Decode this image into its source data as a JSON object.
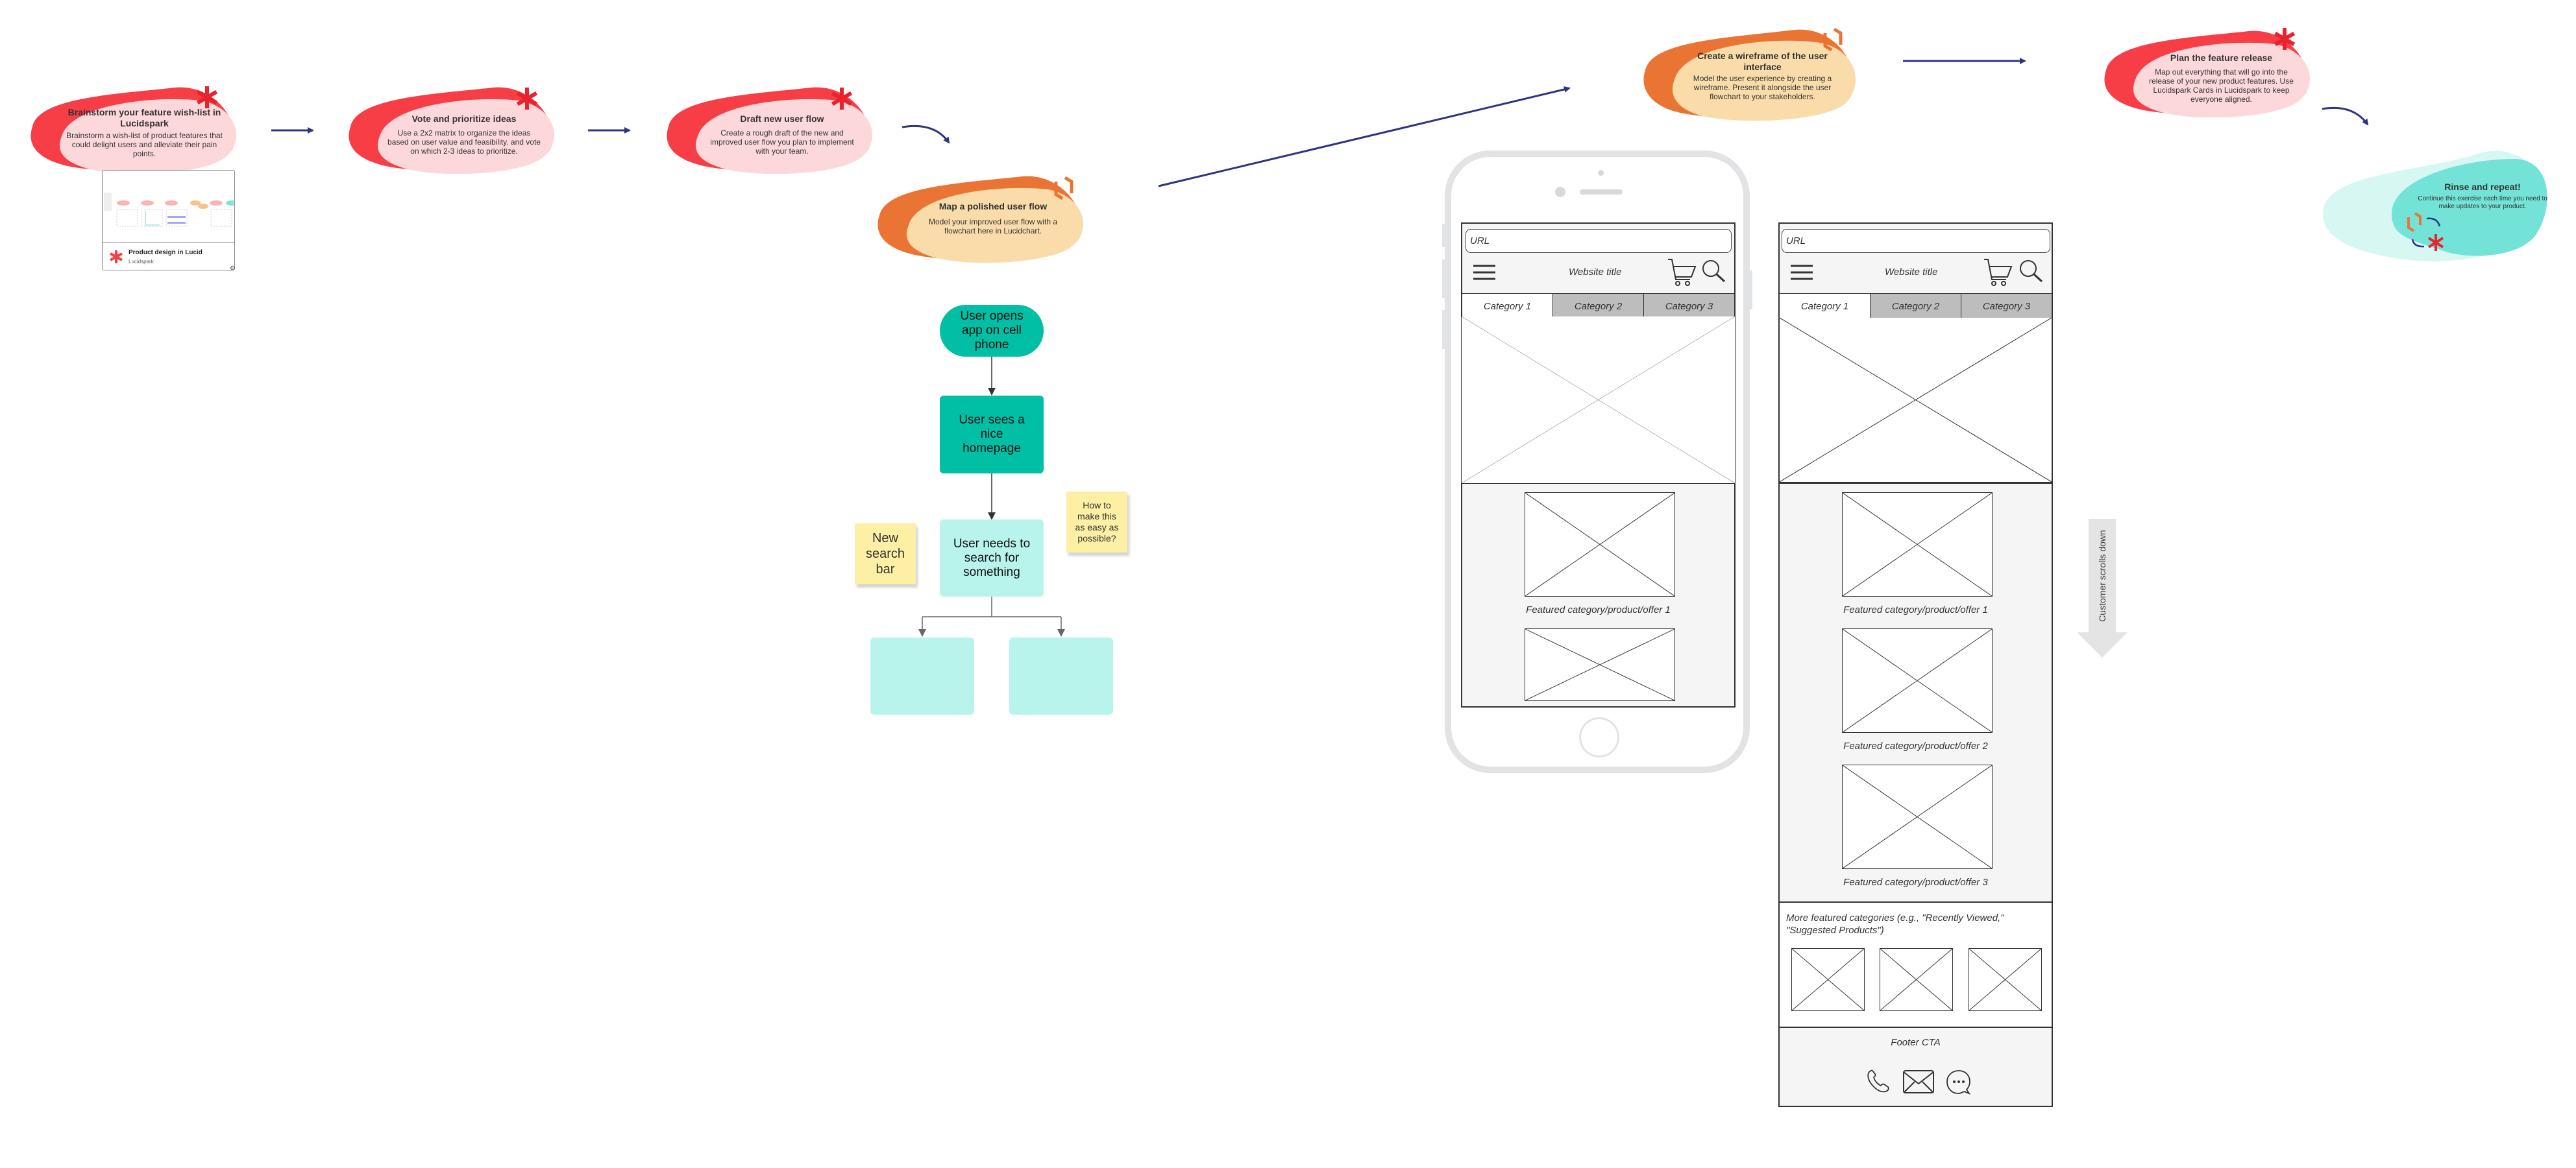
{
  "colors": {
    "spark_red": "#f73d45",
    "spark_pink": "#fdd8da",
    "chart_orange": "#ea7434",
    "chart_peach": "#f9dca9",
    "teal_dark": "#00bfa5",
    "teal_light": "#b8f4ec",
    "teal_blob": "#72e3d6",
    "teal_blob_light": "#d6f7f2",
    "arrow_navy": "#2e3383",
    "sticky_yellow": "#fdf0a4"
  },
  "steps": [
    {
      "id": "brainstorm",
      "title": "Brainstorm your feature wish-list in Lucidspark",
      "body": "Brainstorm a wish-list of product features that could delight users and alleviate their pain points.",
      "icon": "lucidspark-asterisk-icon"
    },
    {
      "id": "vote",
      "title": "Vote and prioritize ideas",
      "body": "Use a 2x2 matrix to organize the ideas based on user value and feasibility. and vote on which 2-3 ideas to prioritize.",
      "icon": "lucidspark-asterisk-icon"
    },
    {
      "id": "draft",
      "title": "Draft new user flow",
      "body": "Create a rough draft of the new and improved user flow you plan to implement with your team.",
      "icon": "lucidspark-asterisk-icon"
    },
    {
      "id": "map",
      "title": "Map a polished user flow",
      "body": "Model your improved user flow with a flowchart here in Lucidchart.",
      "icon": "lucidchart-bracket-icon"
    },
    {
      "id": "wireframe",
      "title": "Create a wireframe of the user interface",
      "body": "Model the user experience by creating a wireframe. Present it alongside the user flowchart to your stakeholders.",
      "icon": "lucidchart-bracket-icon"
    },
    {
      "id": "release",
      "title": "Plan the feature release",
      "body": "Map out everything that will go into the release of your new product features. Use Lucidspark Cards in Lucidspark to keep everyone aligned.",
      "icon": "lucidspark-asterisk-icon"
    },
    {
      "id": "rinse",
      "title": "Rinse and repeat!",
      "body": "Continue this exercise each time you need to make updates to your product.",
      "icon": "cycle-icon"
    }
  ],
  "embed_card": {
    "title": "Product design in Lucid",
    "subtitle": "Lucidspark"
  },
  "flowchart": {
    "nodes": [
      {
        "id": "open",
        "label": "User opens app on cell phone",
        "shape": "terminator"
      },
      {
        "id": "home",
        "label": "User sees a nice homepage",
        "shape": "process"
      },
      {
        "id": "search",
        "label": "User needs to search for something",
        "shape": "process"
      },
      {
        "id": "branch1",
        "label": "",
        "shape": "process"
      },
      {
        "id": "branch2",
        "label": "",
        "shape": "process"
      }
    ],
    "stickies": [
      {
        "text": "New search bar"
      },
      {
        "text": "How to make this as easy as possible?"
      }
    ]
  },
  "wireframe": {
    "url_placeholder": "URL",
    "website_title": "Website title",
    "categories": [
      "Category 1",
      "Category 2",
      "Category 3"
    ],
    "active_category": "Category 1",
    "featured": [
      "Featured category/product/offer 1",
      "Featured category/product/offer 2",
      "Featured category/product/offer 3"
    ],
    "more_featured": "More featured categories (e.g., \"Recently Viewed,\" \"Suggested Products\")",
    "footer_cta": "Footer CTA",
    "scroll_label": "Customer scrolls down"
  }
}
